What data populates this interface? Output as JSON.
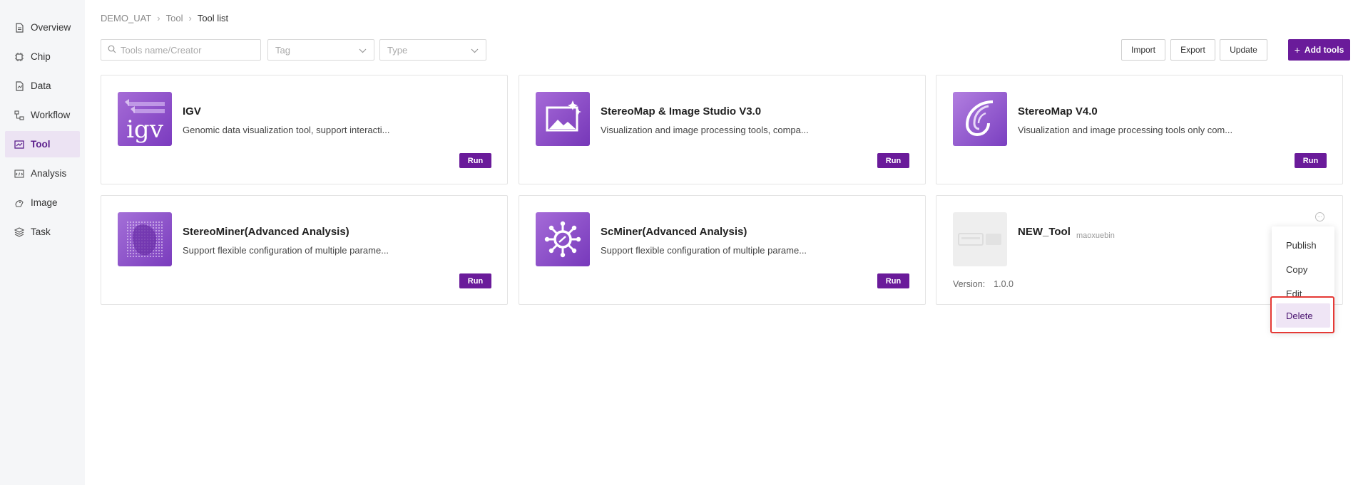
{
  "sidebar": {
    "items": [
      {
        "label": "Overview",
        "icon": "document-icon",
        "active": false
      },
      {
        "label": "Chip",
        "icon": "chip-icon",
        "active": false
      },
      {
        "label": "Data",
        "icon": "file-data-icon",
        "active": false
      },
      {
        "label": "Workflow",
        "icon": "workflow-icon",
        "active": false
      },
      {
        "label": "Tool",
        "icon": "tool-icon",
        "active": true
      },
      {
        "label": "Analysis",
        "icon": "analysis-icon",
        "active": false
      },
      {
        "label": "Image",
        "icon": "image-icon",
        "active": false
      },
      {
        "label": "Task",
        "icon": "layers-icon",
        "active": false
      }
    ]
  },
  "breadcrumb": [
    "DEMO_UAT",
    "Tool",
    "Tool list"
  ],
  "toolbar": {
    "search_placeholder": "Tools name/Creator",
    "tag_placeholder": "Tag",
    "type_placeholder": "Type",
    "import_label": "Import",
    "export_label": "Export",
    "update_label": "Update",
    "add_label": "Add tools"
  },
  "tools": [
    {
      "name": "IGV",
      "desc": "Genomic data visualization tool, support interacti...",
      "run": "Run"
    },
    {
      "name": "StereoMap & Image Studio V3.0",
      "desc": "Visualization and image processing tools, compa...",
      "run": "Run"
    },
    {
      "name": "StereoMap V4.0",
      "desc": "Visualization and image processing tools only com...",
      "run": "Run"
    },
    {
      "name": "StereoMiner(Advanced Analysis)",
      "desc": "Support flexible configuration of multiple parame...",
      "run": "Run"
    },
    {
      "name": "ScMiner(Advanced Analysis)",
      "desc": "Support flexible configuration of multiple parame...",
      "run": "Run"
    }
  ],
  "new_tool": {
    "name": "NEW_Tool",
    "creator": "maoxuebin",
    "version_label": "Version:",
    "version": "1.0.0"
  },
  "menu": {
    "publish": "Publish",
    "copy": "Copy",
    "edit": "Edit",
    "delete": "Delete"
  },
  "colors": {
    "accent": "#6a1b9a",
    "active_bg": "#ece3f3",
    "highlight": "#e53935"
  }
}
